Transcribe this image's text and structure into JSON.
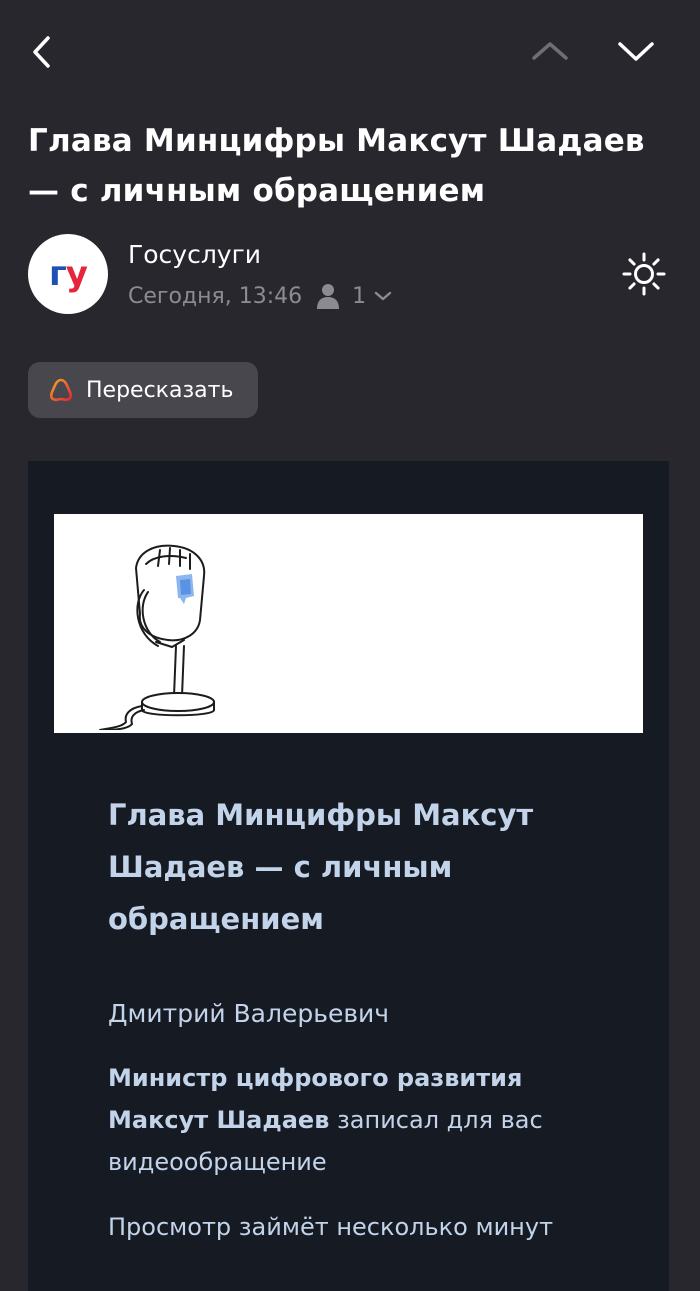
{
  "subject": "Глава Минцифры Максут Шадаев — с личным обращением",
  "sender": {
    "name": "Госуслуги",
    "avatar_text": {
      "g": "г",
      "u": "у"
    },
    "date": "Сегодня, 13:46",
    "recipients_count": "1"
  },
  "retell_button": {
    "label": "Пересказать"
  },
  "email": {
    "title": "Глава Минцифры Максут Шадаев — с личным обращением",
    "greeting": "Дмитрий Валерьевич",
    "paragraph_bold": "Министр цифрового развития Максут Шадаев",
    "paragraph_rest": "записал для вас видеообращение",
    "paragraph2": "Просмотр займёт несколько минут"
  },
  "colors": {
    "background": "#28272d",
    "email_background": "#161a22",
    "email_text": "#c2d3ea",
    "meta_text": "#8c8b92",
    "avatar_blue": "#1e4fb4",
    "avatar_red": "#e4253b",
    "button_bg": "#48474d",
    "alice_gradient_start": "#f5a623",
    "alice_gradient_end": "#e4253b"
  },
  "icons": {
    "back": "chevron-left-icon",
    "prev": "chevron-up-icon",
    "next": "chevron-down-icon",
    "recipients": "person-icon",
    "expand": "chevron-down-small-icon",
    "theme": "sun-icon",
    "retell": "alice-icon",
    "banner": "microphone-illustration"
  }
}
